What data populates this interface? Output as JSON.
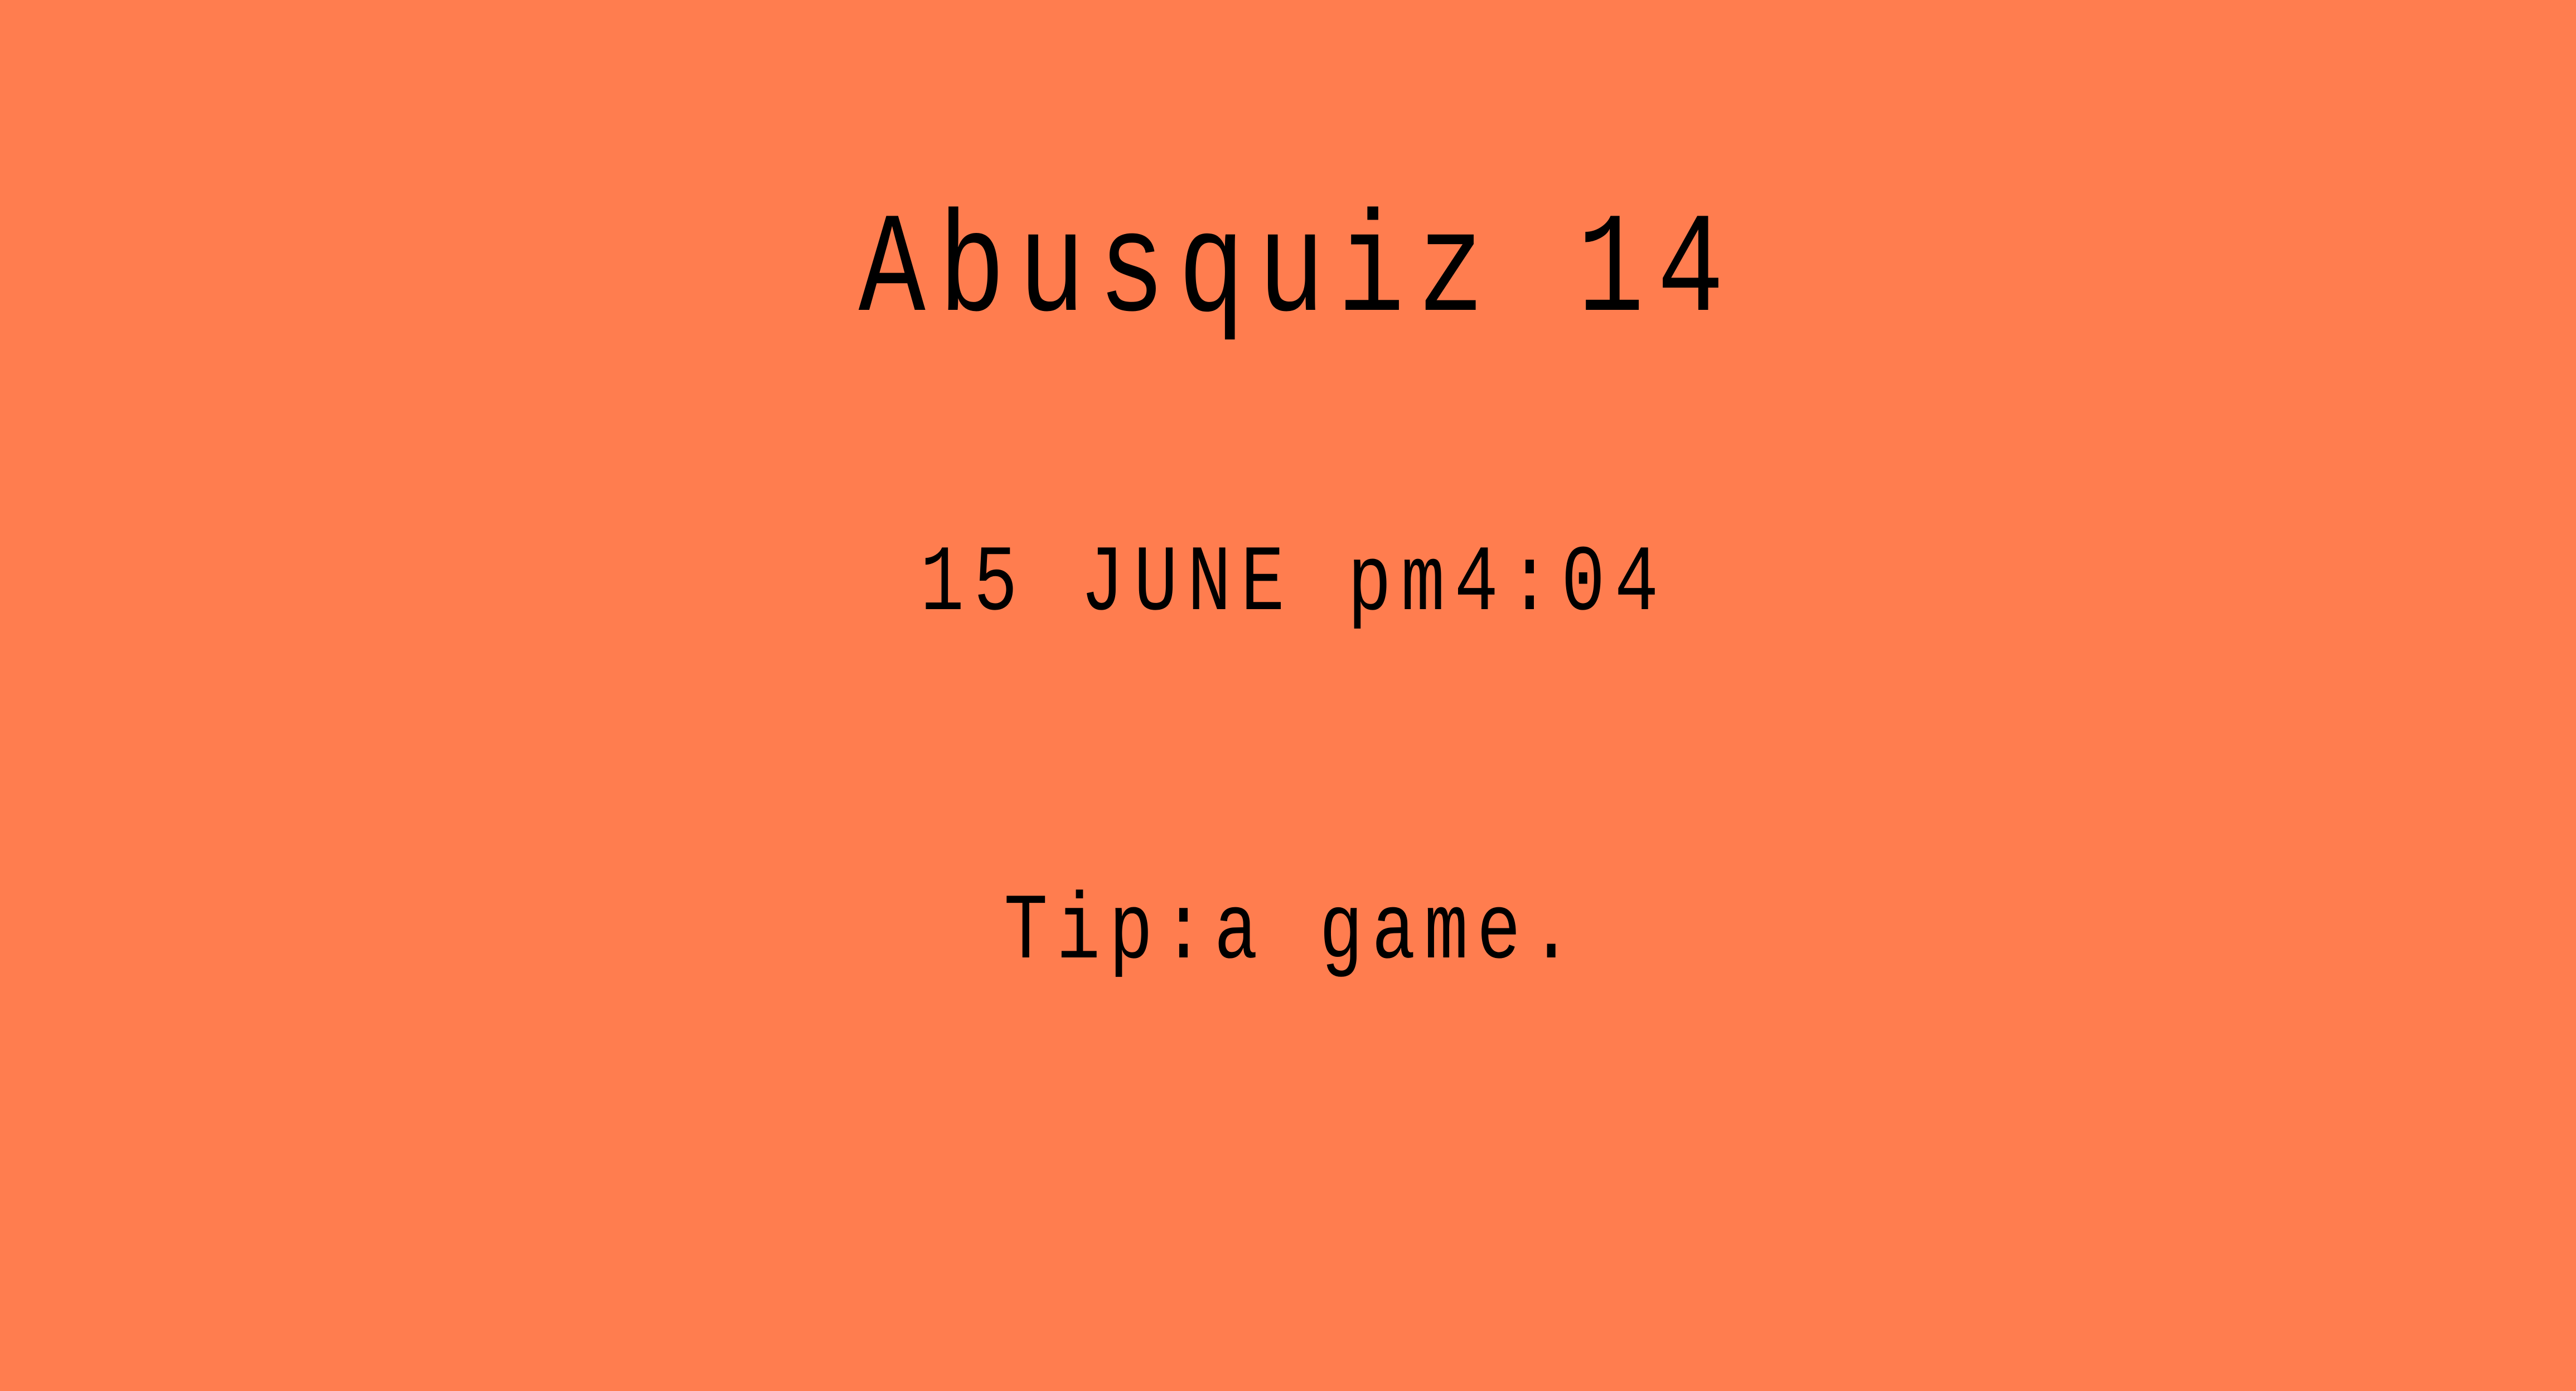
{
  "game": {
    "title": "Abusquiz 14",
    "datetime": "15 JUNE pm4:04",
    "tip": "Tip:a game."
  },
  "colors": {
    "background": "#FF7D4F",
    "text": "#000000"
  }
}
